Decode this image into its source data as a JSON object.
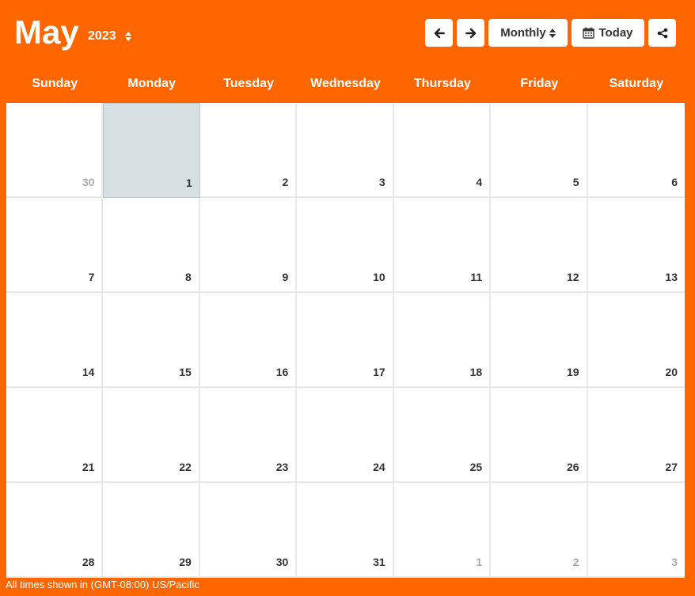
{
  "header": {
    "month": "May",
    "year": "2023",
    "view_label": "Monthly",
    "today_label": "Today"
  },
  "icons": {
    "prev": "arrow-left-icon",
    "next": "arrow-right-icon",
    "today": "calendar-icon",
    "share": "share-icon"
  },
  "colors": {
    "brand": "#ff6600",
    "today_cell": "#d6dfe1",
    "text": "#333333",
    "muted_text": "#aaaaaa"
  },
  "weekdays": [
    "Sunday",
    "Monday",
    "Tuesday",
    "Wednesday",
    "Thursday",
    "Friday",
    "Saturday"
  ],
  "weeks": [
    [
      {
        "day": "30",
        "other": true
      },
      {
        "day": "1",
        "today": true
      },
      {
        "day": "2"
      },
      {
        "day": "3"
      },
      {
        "day": "4"
      },
      {
        "day": "5"
      },
      {
        "day": "6"
      }
    ],
    [
      {
        "day": "7"
      },
      {
        "day": "8"
      },
      {
        "day": "9"
      },
      {
        "day": "10"
      },
      {
        "day": "11"
      },
      {
        "day": "12"
      },
      {
        "day": "13"
      }
    ],
    [
      {
        "day": "14"
      },
      {
        "day": "15"
      },
      {
        "day": "16"
      },
      {
        "day": "17"
      },
      {
        "day": "18"
      },
      {
        "day": "19"
      },
      {
        "day": "20"
      }
    ],
    [
      {
        "day": "21"
      },
      {
        "day": "22"
      },
      {
        "day": "23"
      },
      {
        "day": "24"
      },
      {
        "day": "25"
      },
      {
        "day": "26"
      },
      {
        "day": "27"
      }
    ],
    [
      {
        "day": "28"
      },
      {
        "day": "29"
      },
      {
        "day": "30"
      },
      {
        "day": "31"
      },
      {
        "day": "1",
        "other": true
      },
      {
        "day": "2",
        "other": true
      },
      {
        "day": "3",
        "other": true
      }
    ]
  ],
  "footer": {
    "timezone_note": "All times shown in (GMT-08:00) US/Pacific"
  }
}
